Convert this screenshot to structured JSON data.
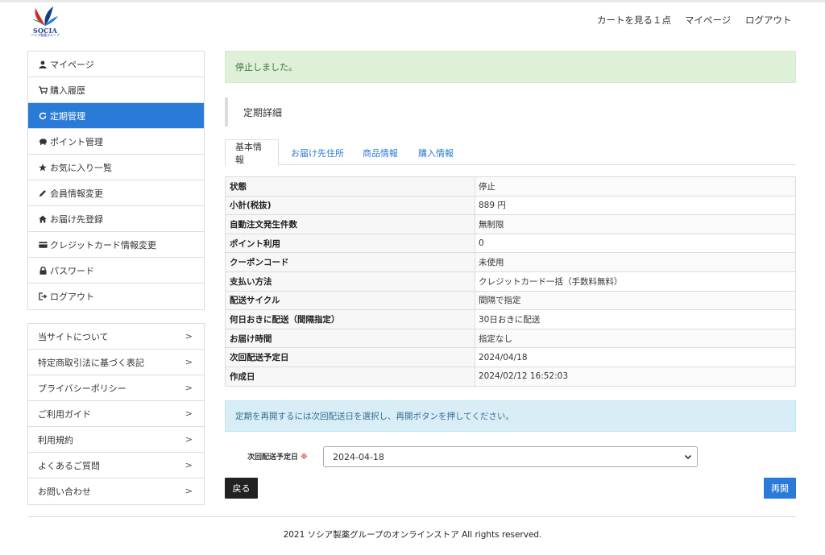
{
  "brand": {
    "logo_text": "SOCIA",
    "logo_sub": "ソシア製薬グループ"
  },
  "header": {
    "cart": "カートを見る１点",
    "mypage": "マイページ",
    "logout": "ログアウト"
  },
  "sidebar": {
    "items": [
      {
        "label": "マイページ",
        "icon": "user-icon",
        "active": false
      },
      {
        "label": "購入履歴",
        "icon": "cart-icon",
        "active": false
      },
      {
        "label": "定期管理",
        "icon": "refresh-icon",
        "active": true
      },
      {
        "label": "ポイント管理",
        "icon": "piggy-bank-icon",
        "active": false
      },
      {
        "label": "お気に入り一覧",
        "icon": "star-icon",
        "active": false
      },
      {
        "label": "会員情報変更",
        "icon": "pencil-icon",
        "active": false
      },
      {
        "label": "お届け先登録",
        "icon": "home-icon",
        "active": false
      },
      {
        "label": "クレジットカード情報変更",
        "icon": "credit-card-icon",
        "active": false
      },
      {
        "label": "パスワード",
        "icon": "lock-icon",
        "active": false
      },
      {
        "label": "ログアウト",
        "icon": "logout-icon",
        "active": false
      }
    ],
    "links": [
      {
        "label": "当サイトについて",
        "chevron": ">"
      },
      {
        "label": "特定商取引法に基づく表記",
        "chevron": ">"
      },
      {
        "label": "プライバシーポリシー",
        "chevron": ">"
      },
      {
        "label": "ご利用ガイド",
        "chevron": ">"
      },
      {
        "label": "利用規約",
        "chevron": ">"
      },
      {
        "label": "よくあるご質問",
        "chevron": ">"
      },
      {
        "label": "お問い合わせ",
        "chevron": ">"
      }
    ]
  },
  "main": {
    "alert_success": "停止しました。",
    "section_title": "定期詳細",
    "tabs": [
      {
        "label": "基本情報",
        "active": true
      },
      {
        "label": "お届け先住所",
        "active": false
      },
      {
        "label": "商品情報",
        "active": false
      },
      {
        "label": "購入情報",
        "active": false
      }
    ],
    "details": [
      {
        "key": "状態",
        "value": "停止"
      },
      {
        "key": "小計(税抜)",
        "value": "889 円"
      },
      {
        "key": "自動注文発生件数",
        "value": "無制限"
      },
      {
        "key": "ポイント利用",
        "value": "0"
      },
      {
        "key": "クーポンコード",
        "value": "未使用"
      },
      {
        "key": "支払い方法",
        "value": "クレジットカード一括（手数料無料）"
      },
      {
        "key": "配送サイクル",
        "value": "間隔で指定"
      },
      {
        "key": "何日おきに配送（間隔指定）",
        "value": "30日おきに配送"
      },
      {
        "key": "お届け時間",
        "value": "指定なし"
      },
      {
        "key": "次回配送予定日",
        "value": "2024/04/18"
      },
      {
        "key": "作成日",
        "value": "2024/02/12 16:52:03"
      }
    ],
    "alert_info": "定期を再開するには次回配送日を選択し、再開ボタンを押してください。",
    "form": {
      "label": "次回配送予定日",
      "required_mark": "※",
      "selected": "2024-04-18"
    },
    "back_button": "戻る",
    "resume_button": "再開"
  },
  "footer": {
    "copyright": "2021 ソシア製薬グループのオンラインストア All rights reserved."
  },
  "colors": {
    "accent": "#2a7bd8",
    "success_bg": "#dff0d8",
    "info_bg": "#d9edf7",
    "dark_button": "#222222"
  }
}
